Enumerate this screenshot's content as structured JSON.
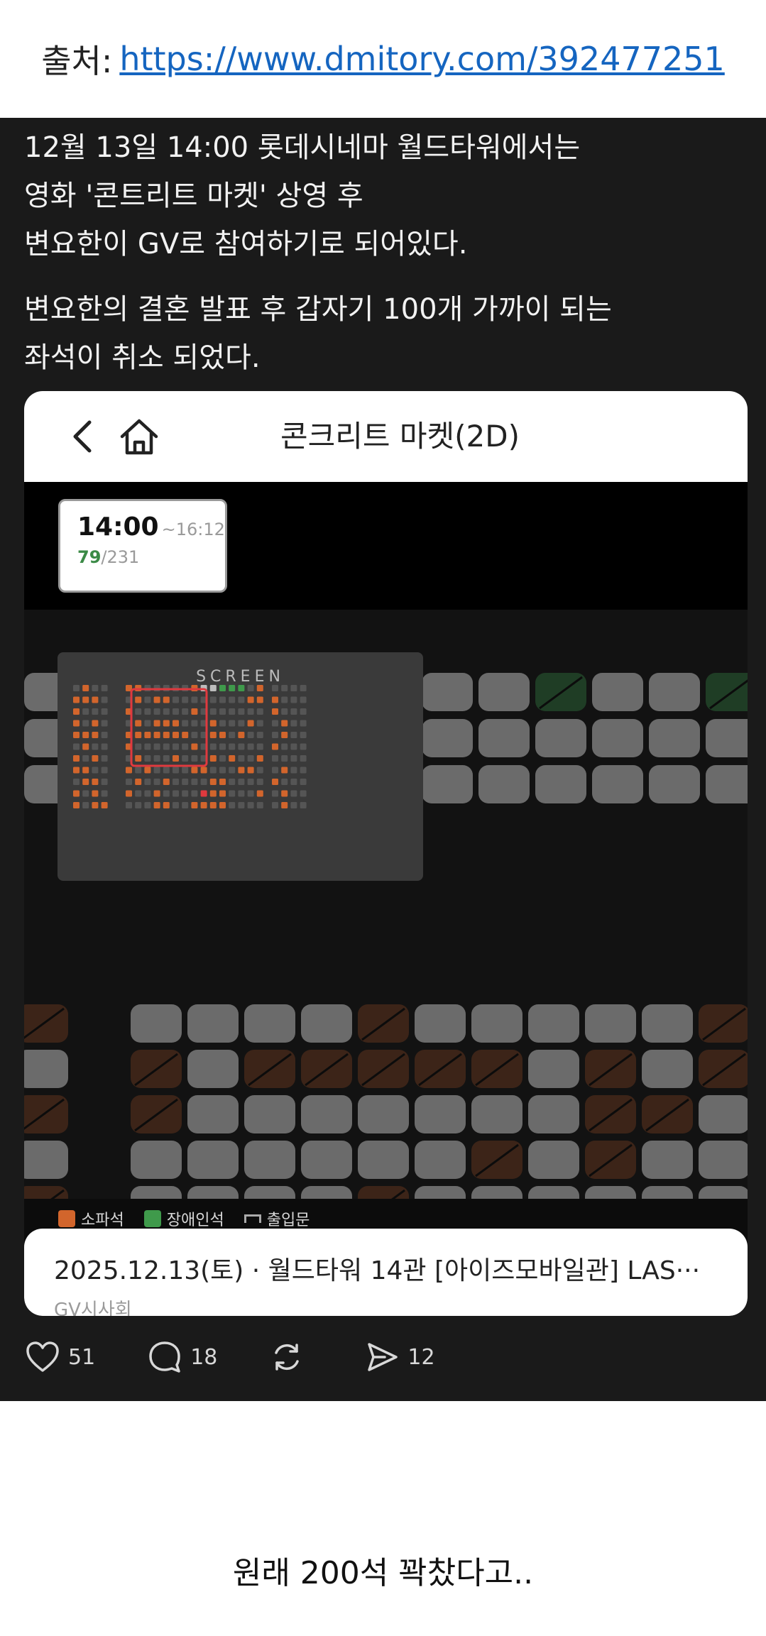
{
  "source": {
    "label": "출처:",
    "url": "https://www.dmitory.com/392477251"
  },
  "post": {
    "paragraph1": [
      "12월 13일 14:00 롯데시네마 월드타워에서는",
      "영화 '콘트리트 마켓' 상영 후",
      "변요한이 GV로 참여하기로 되어있다."
    ],
    "paragraph2": [
      "변요한의 결혼 발표 후 갑자기 100개 가까이 되는",
      "좌석이 취소 되었다."
    ]
  },
  "app": {
    "title": "콘크리트 마켓(2D)",
    "showtime": {
      "start": "14:00",
      "end": "~16:12",
      "available": "79",
      "total": "/231"
    },
    "screen_label": "SCREEN",
    "legend": {
      "sofa": "소파석",
      "accessible": "장애인석",
      "exit": "출입문"
    },
    "info": {
      "main": "2025.12.13(토) · 월드타워 14관 [아이즈모바일관] LAS···",
      "sub": "GV시사회"
    }
  },
  "actions": {
    "likes": "51",
    "comments": "18",
    "reposts": "",
    "shares": "12"
  },
  "caption": "원래 200석 꽉찼다고..",
  "colors": {
    "sold": "#3c2418",
    "available": "#6b6b6b",
    "accessible": "#1f3d25",
    "mini_sold": "#d2652c",
    "mini_free": "#555555",
    "mini_green": "#3f9a4b",
    "highlight": "#e0393e"
  }
}
